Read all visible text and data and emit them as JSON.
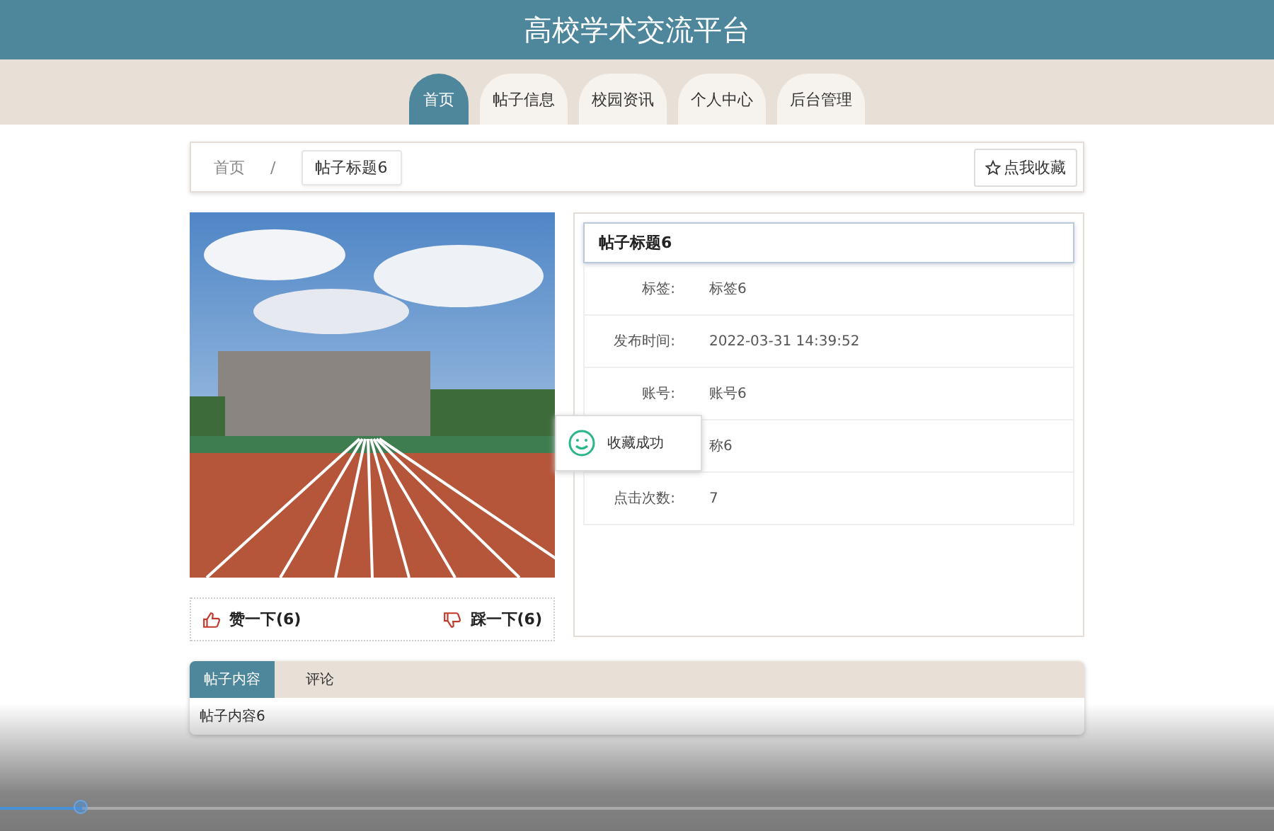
{
  "header": {
    "title": "高校学术交流平台"
  },
  "nav": [
    {
      "label": "首页",
      "selected": true
    },
    {
      "label": "帖子信息",
      "selected": false
    },
    {
      "label": "校园资讯",
      "selected": false
    },
    {
      "label": "个人中心",
      "selected": false
    },
    {
      "label": "后台管理",
      "selected": false
    }
  ],
  "breadcrumb": {
    "home": "首页",
    "separator": "/",
    "current": "帖子标题6",
    "favorite_button": "点我收藏"
  },
  "votes": {
    "like": "赞一下(6)",
    "dislike": "踩一下(6)"
  },
  "details": {
    "title": "帖子标题6",
    "rows": [
      {
        "label": "标签:",
        "value": "标签6"
      },
      {
        "label": "发布时间:",
        "value": "2022-03-31 14:39:52"
      },
      {
        "label": "账号:",
        "value": "账号6"
      },
      {
        "value": "称6"
      },
      {
        "label": "点击次数:",
        "value": "7"
      }
    ]
  },
  "toast": {
    "message": "收藏成功"
  },
  "content_tabs": [
    {
      "label": "帖子内容",
      "selected": true
    },
    {
      "label": "评论",
      "selected": false
    }
  ],
  "content": "帖子内容6",
  "video_progress": {
    "level": 0.064
  }
}
